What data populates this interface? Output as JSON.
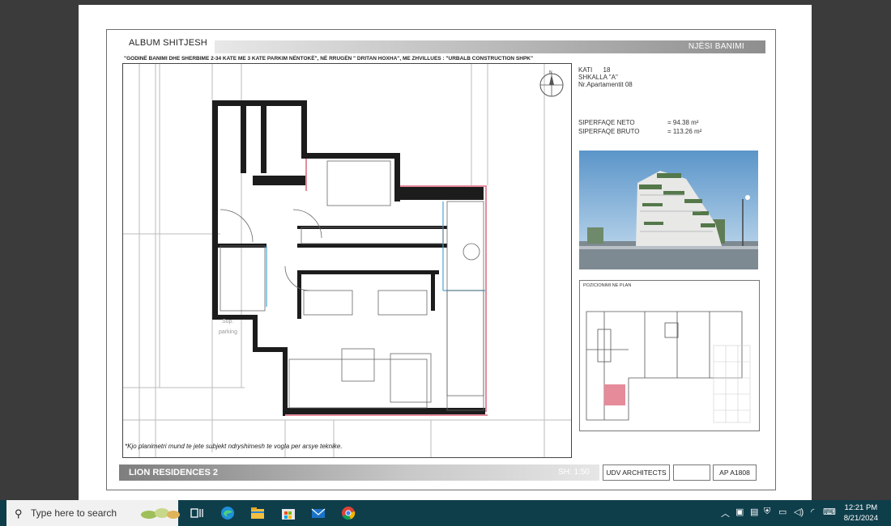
{
  "sheet": {
    "album_title": "ALBUM SHITJESH",
    "unit_label": "NJËSI BANIMI",
    "subtitle": "\"GODINË BANIMI DHE SHERBIME 2-34 KATE  ME 3 KATE PARKIM NËNTOKË\", NË RRUGËN \" DRITAN HOXHA\", ME  ZHVILLUES : \"URBALB CONSTRUCTION SHPK\"",
    "info": {
      "floor_label": "KATI",
      "floor_value": "18",
      "stair_label": "SHKALLA \"A\"",
      "apt_label": "Nr.Apartamentit",
      "apt_value": "08"
    },
    "area": {
      "net_label": "SIPERFAQE NETO",
      "net_value": "= 94.38 m²",
      "gross_label": "SIPERFAQE BRUTO",
      "gross_value": "= 113.26 m²"
    },
    "compass_letter": "N",
    "plan_room_label": "Sup.\nparking",
    "position_label": "POZICIONIMI NE PLAN",
    "note": "*Kjo planimetri mund te jete subjekt ndryshimesh te vogla per arsye teknike.",
    "footer": {
      "project": "LION  RESIDENCES 2",
      "scale": "SH: 1:50",
      "architect": "UDV ARCHITECTS",
      "code": "AP  A1808"
    }
  },
  "taskbar": {
    "search_placeholder": "Type here to search",
    "time": "12:21 PM",
    "date": "8/21/2024",
    "icons": [
      "task-view-icon",
      "edge-icon",
      "file-explorer-icon",
      "store-icon",
      "mail-icon",
      "chrome-icon"
    ],
    "colors": {
      "taskbar": "#0f3e4b",
      "plan_wall": "#1c1c1c",
      "highlight": "#e58b9a"
    }
  }
}
